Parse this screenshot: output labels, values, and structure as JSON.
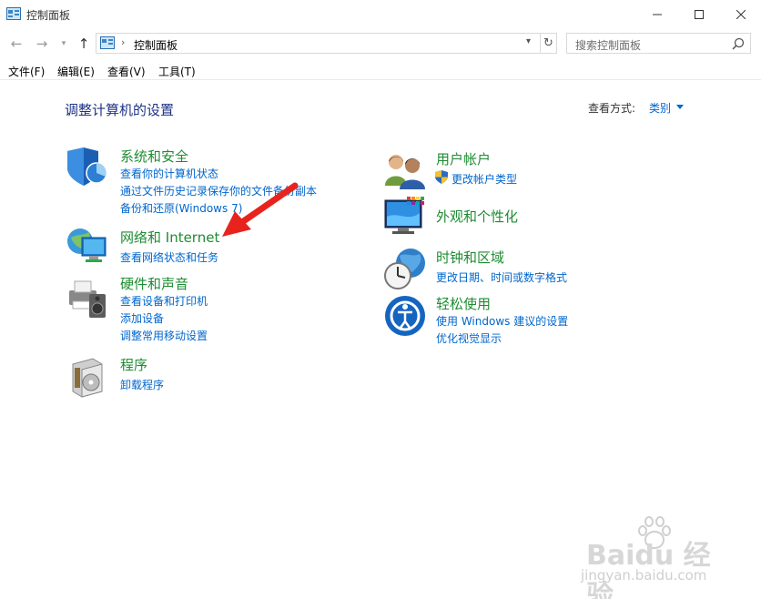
{
  "window": {
    "title": "控制面板"
  },
  "nav": {
    "address": "控制面板",
    "search_placeholder": "搜索控制面板"
  },
  "menu": {
    "file": "文件(F)",
    "edit": "编辑(E)",
    "view": "查看(V)",
    "tools": "工具(T)"
  },
  "content": {
    "title": "调整计算机的设置",
    "view_by_label": "查看方式:",
    "view_by_value": "类别"
  },
  "categories": {
    "system_security": {
      "title": "系统和安全",
      "links": [
        "查看你的计算机状态",
        "通过文件历史记录保存你的文件备份副本",
        "备份和还原(Windows 7)"
      ]
    },
    "network": {
      "title": "网络和 Internet",
      "links": [
        "查看网络状态和任务"
      ]
    },
    "hardware": {
      "title": "硬件和声音",
      "links": [
        "查看设备和打印机",
        "添加设备",
        "调整常用移动设置"
      ]
    },
    "programs": {
      "title": "程序",
      "links": [
        "卸载程序"
      ]
    },
    "user_accounts": {
      "title": "用户帐户",
      "links": [
        "更改帐户类型"
      ]
    },
    "appearance": {
      "title": "外观和个性化"
    },
    "clock_region": {
      "title": "时钟和区域",
      "links": [
        "更改日期、时间或数字格式"
      ]
    },
    "ease_of_access": {
      "title": "轻松使用",
      "links": [
        "使用 Windows 建议的设置",
        "优化视觉显示"
      ]
    }
  },
  "watermark": {
    "brand": "Baidu 经验",
    "url": "jingyan.baidu.com"
  },
  "colors": {
    "category_title": "#1e8c32",
    "link": "#0066cc",
    "page_title": "#1e3287",
    "annotation": "#e8231e"
  }
}
